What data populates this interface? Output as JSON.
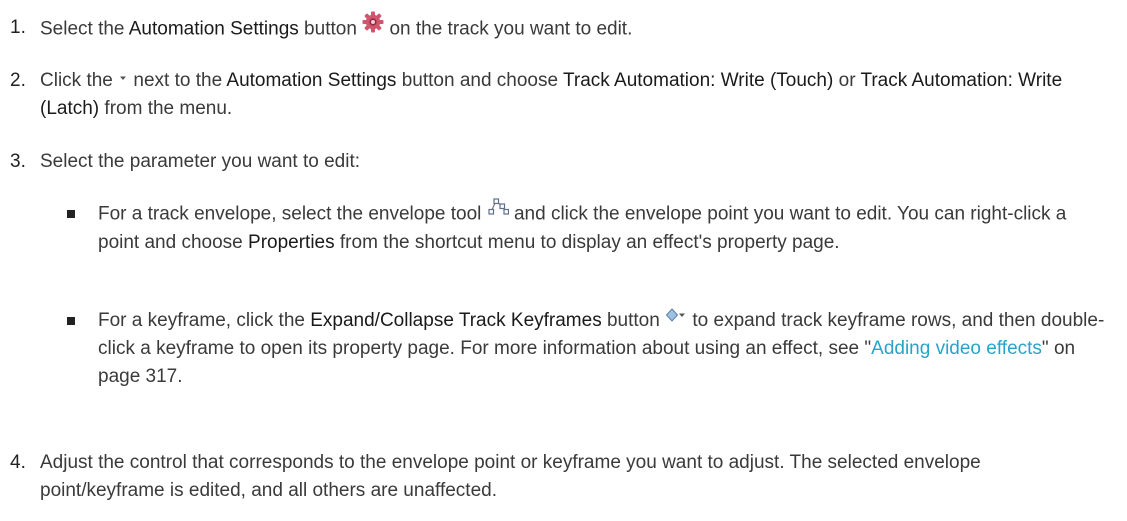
{
  "steps": [
    {
      "number": "1.",
      "parts": [
        {
          "t": "text",
          "v": "Select the "
        },
        {
          "t": "ui",
          "v": "Automation Settings"
        },
        {
          "t": "text",
          "v": " button "
        },
        {
          "t": "icon",
          "name": "gear-icon"
        },
        {
          "t": "text",
          "v": " on the track you want to edit."
        }
      ]
    },
    {
      "number": "2.",
      "parts": [
        {
          "t": "text",
          "v": "Click the "
        },
        {
          "t": "icon",
          "name": "small-arrow-down-icon"
        },
        {
          "t": "text",
          "v": " next to the "
        },
        {
          "t": "ui",
          "v": "Automation Settings"
        },
        {
          "t": "text",
          "v": " button and choose "
        },
        {
          "t": "ui",
          "v": "Track Automation: Write (Touch)"
        },
        {
          "t": "text",
          "v": " or "
        },
        {
          "t": "ui",
          "v": "Track Automation: Write (Latch)"
        },
        {
          "t": "text",
          "v": " from the menu."
        }
      ]
    },
    {
      "number": "3.",
      "parts": [
        {
          "t": "text",
          "v": "Select the parameter you want to edit:"
        }
      ]
    },
    {
      "number": "4.",
      "parts": [
        {
          "t": "text",
          "v": "Adjust the control that corresponds to the envelope point or keyframe you want to adjust. The selected envelope point/keyframe is edited, and all others are unaffected."
        }
      ]
    }
  ],
  "bullets": [
    {
      "parts": [
        {
          "t": "text",
          "v": "For a track envelope, select the envelope tool "
        },
        {
          "t": "icon",
          "name": "envelope-tool-icon"
        },
        {
          "t": "text",
          "v": " and click the envelope point you want to edit. You can right-click a point and choose "
        },
        {
          "t": "ui",
          "v": "Properties"
        },
        {
          "t": "text",
          "v": " from the shortcut menu to display an effect's property page."
        }
      ]
    },
    {
      "parts": [
        {
          "t": "text",
          "v": "For a keyframe, click the "
        },
        {
          "t": "ui",
          "v": "Expand/Collapse Track Keyframes"
        },
        {
          "t": "text",
          "v": " button "
        },
        {
          "t": "icon",
          "name": "expand-keyframes-icon"
        },
        {
          "t": "text",
          "v": " to expand track keyframe rows, and then double-click a keyframe to open its property page. For more information about using an effect, see \""
        },
        {
          "t": "link",
          "v": "Adding video effects"
        },
        {
          "t": "text",
          "v": "\" on page 317."
        }
      ]
    }
  ],
  "colors": {
    "link": "#2aa3c8",
    "gear_icon": "#d2556e",
    "body_text": "#3a3a3a"
  }
}
